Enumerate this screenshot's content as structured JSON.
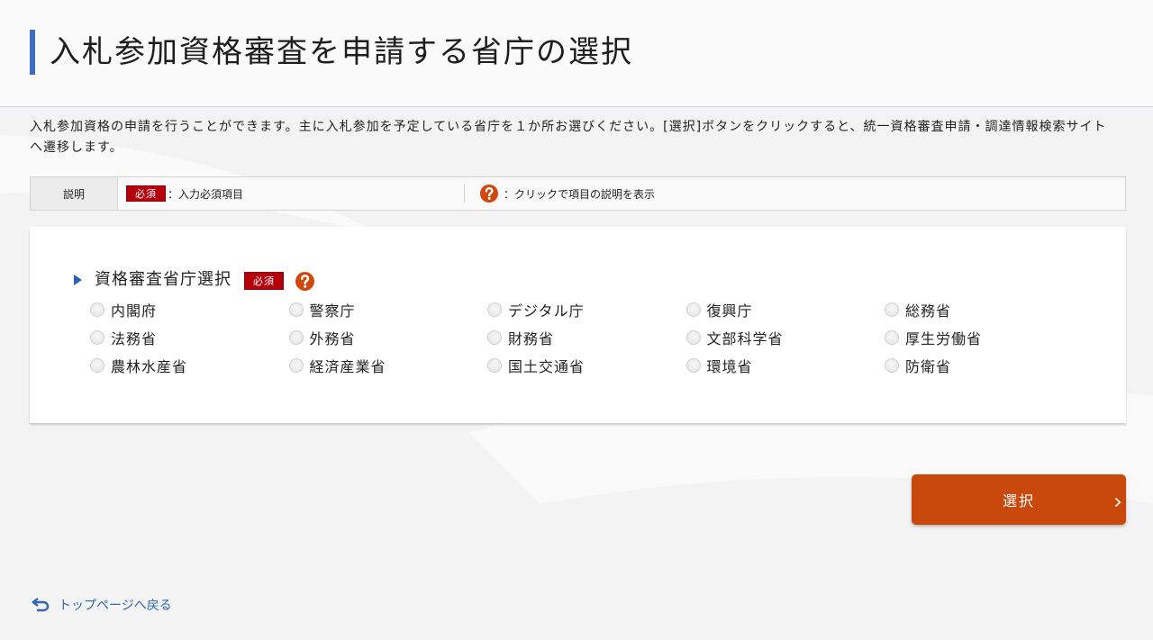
{
  "header": {
    "title": "入札参加資格審査を申請する省庁の選択"
  },
  "intro": {
    "text": "入札参加資格の申請を行うことができます。主に入札参加を予定している省庁を１か所お選びください。[選択]ボタンをクリックすると、統一資格審査申請・調達情報検索サイトへ遷移します。"
  },
  "legend": {
    "label": "説明",
    "required_badge": "必須",
    "required_text": "：入力必須項目",
    "help_text": "：クリックで項目の説明を表示"
  },
  "form": {
    "section_label": "資格審査省庁選択",
    "required_badge": "必須",
    "options": [
      "内閣府",
      "警察庁",
      "デジタル庁",
      "復興庁",
      "総務省",
      "法務省",
      "外務省",
      "財務省",
      "文部科学省",
      "厚生労働省",
      "農林水産省",
      "経済産業省",
      "国土交通省",
      "環境省",
      "防衛省"
    ]
  },
  "actions": {
    "select_label": "選択"
  },
  "footer": {
    "back_link_label": "トップページへ戻る"
  },
  "icons": {
    "section_marker": "triangle-right-icon",
    "help": "help-icon",
    "select_chevron": "chevron-right-icon",
    "back": "return-arrow-icon",
    "radio": "radio-unselected"
  },
  "colors": {
    "accent_blue": "#3b6cc7",
    "required_red": "#b5000c",
    "help_orange": "#d0480c",
    "primary_button": "#c9480c",
    "link_blue": "#2f66b3"
  }
}
